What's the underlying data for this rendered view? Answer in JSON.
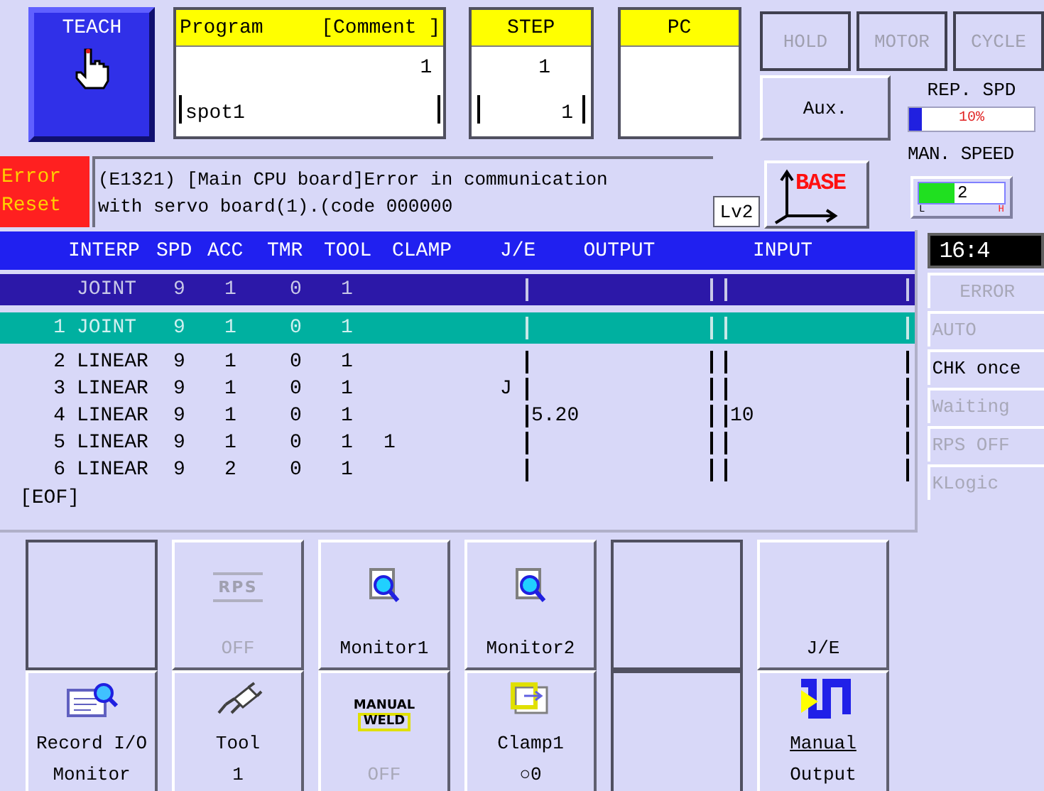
{
  "mode": {
    "label": "TEACH"
  },
  "program": {
    "header": "Program",
    "comment_header": "[Comment ]",
    "number": "1",
    "comment": "spot1"
  },
  "step": {
    "header": "STEP",
    "value": "1",
    "total": "1"
  },
  "pc": {
    "header": "PC"
  },
  "status_buttons": [
    {
      "label": "HOLD",
      "disabled": true
    },
    {
      "label": "MOTOR",
      "disabled": true
    },
    {
      "label": "CYCLE",
      "disabled": true
    }
  ],
  "aux_button": {
    "label": "Aux."
  },
  "rep_speed": {
    "label": "REP. SPD",
    "level": 0.1,
    "reading": "10%"
  },
  "error": {
    "button": [
      "Error",
      "Reset"
    ],
    "message": [
      "(E1321) [Main CPU board]Error in communication",
      "with servo board(1).(code 000000"
    ],
    "level": "Lv2"
  },
  "coordinate": {
    "label": "BASE"
  },
  "manual_speed": {
    "label": "MAN. SPEED",
    "level": 0.42,
    "reading": "2",
    "low": "L",
    "high": "H"
  },
  "table": {
    "columns": [
      "INTERP",
      "SPD",
      "ACC",
      "TMR",
      "TOOL",
      "CLAMP",
      "J/E",
      "OUTPUT",
      "INPUT"
    ],
    "rows": [
      {
        "kind": "start",
        "selected": false,
        "interp": "JOINT",
        "spd": "9",
        "acc": "1",
        "tmr": "0",
        "tool": "1"
      },
      {
        "kind": "step",
        "selected": true,
        "number": "1",
        "interp": "JOINT",
        "spd": "9",
        "acc": "1",
        "tmr": "0",
        "tool": "1"
      },
      {
        "kind": "step",
        "selected": false,
        "number": "2",
        "interp": "LINEAR",
        "spd": "9",
        "acc": "1",
        "tmr": "0",
        "tool": "1"
      },
      {
        "kind": "step",
        "selected": false,
        "number": "3",
        "interp": "LINEAR",
        "spd": "9",
        "acc": "1",
        "tmr": "0",
        "tool": "1",
        "je": "J"
      },
      {
        "kind": "step",
        "selected": false,
        "number": "4",
        "interp": "LINEAR",
        "spd": "9",
        "acc": "1",
        "tmr": "0",
        "tool": "1",
        "output": "5.20",
        "input": "10"
      },
      {
        "kind": "step",
        "selected": false,
        "number": "5",
        "interp": "LINEAR",
        "spd": "9",
        "acc": "1",
        "tmr": "0",
        "tool": "1",
        "clamp": "1"
      },
      {
        "kind": "step",
        "selected": false,
        "number": "6",
        "interp": "LINEAR",
        "spd": "9",
        "acc": "2",
        "tmr": "0",
        "tool": "1"
      }
    ],
    "end_marker": "[EOF]"
  },
  "clock": "16:4",
  "status_list": [
    {
      "label": "ERROR",
      "on": false
    },
    {
      "label": "AUTO",
      "on": false
    },
    {
      "label": "CHK once",
      "on": true
    },
    {
      "label": "Waiting",
      "on": false
    },
    {
      "label": "RPS OFF",
      "on": false
    },
    {
      "label": "KLogic",
      "on": false
    }
  ],
  "function_keys": [
    {
      "kind": "empty"
    },
    {
      "kind": "rps",
      "icon_text": "RPS",
      "lines": [
        "OFF"
      ],
      "disabled": true
    },
    {
      "kind": "monitor",
      "lines": [
        "Monitor1"
      ],
      "disabled": false
    },
    {
      "kind": "monitor",
      "lines": [
        "Monitor2"
      ],
      "disabled": false
    },
    {
      "kind": "empty"
    },
    {
      "kind": "text",
      "lines": [
        "J/E"
      ],
      "disabled": false
    },
    {
      "kind": "record",
      "lines": [
        "Record I/O",
        "Monitor"
      ],
      "disabled": false
    },
    {
      "kind": "tool",
      "lines": [
        "Tool",
        "1"
      ],
      "disabled": false
    },
    {
      "kind": "weld",
      "icon_text": [
        "MANUAL",
        "WELD"
      ],
      "lines": [
        "OFF"
      ],
      "disabled": true
    },
    {
      "kind": "clamp",
      "lines": [
        "Clamp1",
        "○0"
      ],
      "disabled": false
    },
    {
      "kind": "empty"
    },
    {
      "kind": "output",
      "lines": [
        "Manual",
        "Output"
      ],
      "disabled": false
    }
  ]
}
